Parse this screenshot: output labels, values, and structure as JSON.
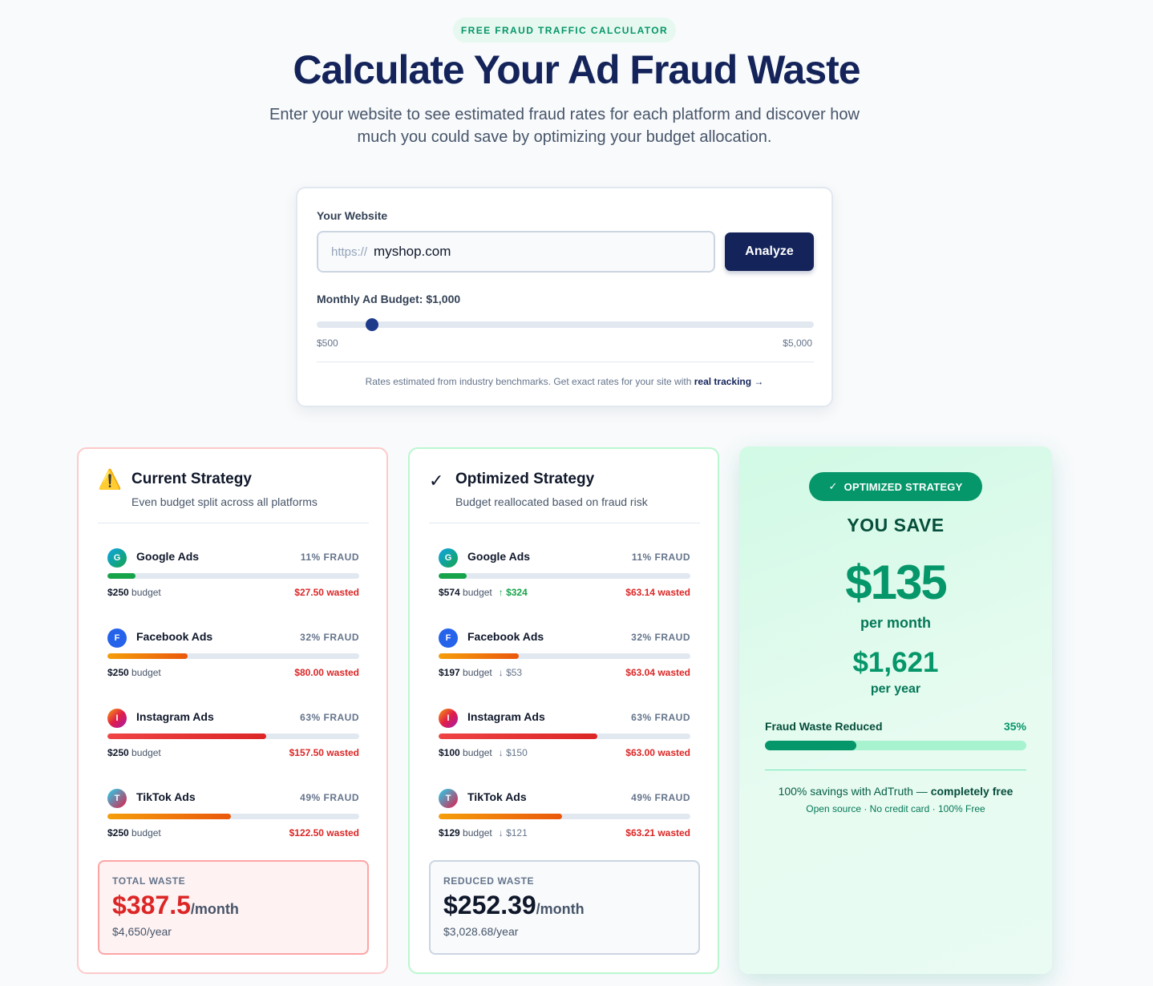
{
  "header": {
    "badge": "FREE FRAUD TRAFFIC CALCULATOR",
    "title": "Calculate Your Ad Fraud Waste",
    "subtitle": "Enter your website to see estimated fraud rates for each platform and discover how much you could save by optimizing your budget allocation."
  },
  "form": {
    "website_label": "Your Website",
    "url_prefix": "https://",
    "url_value": "myshop.com",
    "analyze_label": "Analyze",
    "budget_label": "Monthly Ad Budget: $1,000",
    "budget_fraction": 0.111,
    "range_min": "$500",
    "range_max": "$5,000",
    "footnote_text": "Rates estimated from industry benchmarks. Get exact rates for your site with ",
    "footnote_link": "real tracking →"
  },
  "current": {
    "icon": "warning-icon",
    "title": "Current Strategy",
    "subtitle": "Even budget split across all platforms",
    "platforms": [
      {
        "letter": "G",
        "name": "Google Ads",
        "fraud": "11% FRAUD",
        "fraud_pct": 11,
        "budget": "$250",
        "budget_suffix": "budget",
        "change": "",
        "wasted": "$27.50 wasted"
      },
      {
        "letter": "F",
        "name": "Facebook Ads",
        "fraud": "32% FRAUD",
        "fraud_pct": 32,
        "budget": "$250",
        "budget_suffix": "budget",
        "change": "",
        "wasted": "$80.00 wasted"
      },
      {
        "letter": "I",
        "name": "Instagram Ads",
        "fraud": "63% FRAUD",
        "fraud_pct": 63,
        "budget": "$250",
        "budget_suffix": "budget",
        "change": "",
        "wasted": "$157.50 wasted"
      },
      {
        "letter": "T",
        "name": "TikTok Ads",
        "fraud": "49% FRAUD",
        "fraud_pct": 49,
        "budget": "$250",
        "budget_suffix": "budget",
        "change": "",
        "wasted": "$122.50 wasted"
      }
    ],
    "total_label": "TOTAL WASTE",
    "total_amount": "$387.5",
    "total_unit": "/month",
    "total_year": "$4,650/year"
  },
  "optimized": {
    "icon": "checkmark-icon",
    "title": "Optimized Strategy",
    "subtitle": "Budget reallocated based on fraud risk",
    "platforms": [
      {
        "letter": "G",
        "name": "Google Ads",
        "fraud": "11% FRAUD",
        "fraud_pct": 11,
        "budget": "$574",
        "budget_suffix": "budget",
        "change": "↑ $324",
        "dir": "up",
        "wasted": "$63.14 wasted"
      },
      {
        "letter": "F",
        "name": "Facebook Ads",
        "fraud": "32% FRAUD",
        "fraud_pct": 32,
        "budget": "$197",
        "budget_suffix": "budget",
        "change": "↓ $53",
        "dir": "down",
        "wasted": "$63.04 wasted"
      },
      {
        "letter": "I",
        "name": "Instagram Ads",
        "fraud": "63% FRAUD",
        "fraud_pct": 63,
        "budget": "$100",
        "budget_suffix": "budget",
        "change": "↓ $150",
        "dir": "down",
        "wasted": "$63.00 wasted"
      },
      {
        "letter": "T",
        "name": "TikTok Ads",
        "fraud": "49% FRAUD",
        "fraud_pct": 49,
        "budget": "$129",
        "budget_suffix": "budget",
        "change": "↓ $121",
        "dir": "down",
        "wasted": "$63.21 wasted"
      }
    ],
    "total_label": "REDUCED WASTE",
    "total_amount": "$252.39",
    "total_unit": "/month",
    "total_year": "$3,028.68/year"
  },
  "savings": {
    "pill_icon": "check-icon",
    "pill": "OPTIMIZED STRATEGY",
    "you_save": "YOU SAVE",
    "monthly": "$135",
    "per_month": "per month",
    "yearly": "$1,621",
    "per_year": "per year",
    "reduced_label": "Fraud Waste Reduced",
    "reduced_pct_text": "35%",
    "reduced_pct": 35,
    "note_text": "100% savings with AdTruth — ",
    "note_bold": "completely free",
    "fine": "Open source · No credit card · 100% Free"
  },
  "colors": {
    "navy": "#14245a",
    "green": "#059669",
    "red": "#dc2626"
  }
}
